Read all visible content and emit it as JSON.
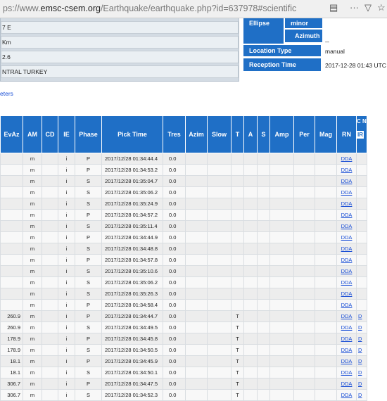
{
  "browser": {
    "url_prefix": "ps://www.",
    "url_host": "emsc-csem.org",
    "url_path": "/Earthquake/earthquake.php?id=637978#scientific"
  },
  "info": {
    "left_rows": [
      "7 E",
      "Km",
      "2.6",
      "NTRAL TURKEY"
    ],
    "ellipse_label": "Ellipse",
    "minor_label": "minor",
    "azimuth_label": "Azimuth",
    "azimuth_value": "--",
    "location_type_label": "Location Type",
    "location_type_value": "manual",
    "reception_time_label": "Reception Time",
    "reception_time_value": "2017-12-28 01:43 UTC"
  },
  "link_text": "eters",
  "table": {
    "headers": [
      "EvAz",
      "AM",
      "CD",
      "IE",
      "Phase",
      "Pick Time",
      "Tres",
      "Azim",
      "Slow",
      "T",
      "A",
      "S",
      "Amp",
      "Per",
      "Mag",
      "RN",
      "C N"
    ],
    "subheader_ir": "IR",
    "rows": [
      {
        "evaz": "",
        "am": "m",
        "ie": "i",
        "phase": "P",
        "time": "2017/12/28 01:34:44.4",
        "tres": "0.0",
        "t": "",
        "rn": "DDA",
        "last": ""
      },
      {
        "evaz": "",
        "am": "m",
        "ie": "i",
        "phase": "P",
        "time": "2017/12/28 01:34:53.2",
        "tres": "0.0",
        "t": "",
        "rn": "DDA",
        "last": ""
      },
      {
        "evaz": "",
        "am": "m",
        "ie": "i",
        "phase": "S",
        "time": "2017/12/28 01:35:04.7",
        "tres": "0.0",
        "t": "",
        "rn": "DDA",
        "last": ""
      },
      {
        "evaz": "",
        "am": "m",
        "ie": "i",
        "phase": "S",
        "time": "2017/12/28 01:35:06.2",
        "tres": "0.0",
        "t": "",
        "rn": "DDA",
        "last": ""
      },
      {
        "evaz": "",
        "am": "m",
        "ie": "i",
        "phase": "S",
        "time": "2017/12/28 01:35:24.9",
        "tres": "0.0",
        "t": "",
        "rn": "DDA",
        "last": ""
      },
      {
        "evaz": "",
        "am": "m",
        "ie": "i",
        "phase": "P",
        "time": "2017/12/28 01:34:57.2",
        "tres": "0.0",
        "t": "",
        "rn": "DDA",
        "last": ""
      },
      {
        "evaz": "",
        "am": "m",
        "ie": "i",
        "phase": "S",
        "time": "2017/12/28 01:35:11.4",
        "tres": "0.0",
        "t": "",
        "rn": "DDA",
        "last": ""
      },
      {
        "evaz": "",
        "am": "m",
        "ie": "i",
        "phase": "P",
        "time": "2017/12/28 01:34:44.9",
        "tres": "0.0",
        "t": "",
        "rn": "DDA",
        "last": ""
      },
      {
        "evaz": "",
        "am": "m",
        "ie": "i",
        "phase": "S",
        "time": "2017/12/28 01:34:48.8",
        "tres": "0.0",
        "t": "",
        "rn": "DDA",
        "last": ""
      },
      {
        "evaz": "",
        "am": "m",
        "ie": "i",
        "phase": "P",
        "time": "2017/12/28 01:34:57.8",
        "tres": "0.0",
        "t": "",
        "rn": "DDA",
        "last": ""
      },
      {
        "evaz": "",
        "am": "m",
        "ie": "i",
        "phase": "S",
        "time": "2017/12/28 01:35:10.6",
        "tres": "0.0",
        "t": "",
        "rn": "DDA",
        "last": ""
      },
      {
        "evaz": "",
        "am": "m",
        "ie": "i",
        "phase": "S",
        "time": "2017/12/28 01:35:06.2",
        "tres": "0.0",
        "t": "",
        "rn": "DDA",
        "last": ""
      },
      {
        "evaz": "",
        "am": "m",
        "ie": "i",
        "phase": "S",
        "time": "2017/12/28 01:35:26.3",
        "tres": "0.0",
        "t": "",
        "rn": "DDA",
        "last": ""
      },
      {
        "evaz": "",
        "am": "m",
        "ie": "i",
        "phase": "P",
        "time": "2017/12/28 01:34:58.4",
        "tres": "0.0",
        "t": "",
        "rn": "DDA",
        "last": ""
      },
      {
        "evaz": "260.9",
        "am": "m",
        "ie": "i",
        "phase": "P",
        "time": "2017/12/28 01:34:44.7",
        "tres": "0.0",
        "t": "T",
        "rn": "DDA",
        "last": "D"
      },
      {
        "evaz": "260.9",
        "am": "m",
        "ie": "i",
        "phase": "S",
        "time": "2017/12/28 01:34:49.5",
        "tres": "0.0",
        "t": "T",
        "rn": "DDA",
        "last": "D"
      },
      {
        "evaz": "178.9",
        "am": "m",
        "ie": "i",
        "phase": "P",
        "time": "2017/12/28 01:34:45.8",
        "tres": "0.0",
        "t": "T",
        "rn": "DDA",
        "last": "D"
      },
      {
        "evaz": "178.9",
        "am": "m",
        "ie": "i",
        "phase": "S",
        "time": "2017/12/28 01:34:50.5",
        "tres": "0.0",
        "t": "T",
        "rn": "DDA",
        "last": "D"
      },
      {
        "evaz": "18.1",
        "am": "m",
        "ie": "i",
        "phase": "P",
        "time": "2017/12/28 01:34:45.9",
        "tres": "0.0",
        "t": "T",
        "rn": "DDA",
        "last": "D"
      },
      {
        "evaz": "18.1",
        "am": "m",
        "ie": "i",
        "phase": "S",
        "time": "2017/12/28 01:34:50.1",
        "tres": "0.0",
        "t": "T",
        "rn": "DDA",
        "last": "D"
      },
      {
        "evaz": "306.7",
        "am": "m",
        "ie": "i",
        "phase": "P",
        "time": "2017/12/28 01:34:47.5",
        "tres": "0.0",
        "t": "T",
        "rn": "DDA",
        "last": "D"
      },
      {
        "evaz": "306.7",
        "am": "m",
        "ie": "i",
        "phase": "S",
        "time": "2017/12/28 01:34:52.3",
        "tres": "0.0",
        "t": "T",
        "rn": "DDA",
        "last": "D"
      }
    ]
  }
}
